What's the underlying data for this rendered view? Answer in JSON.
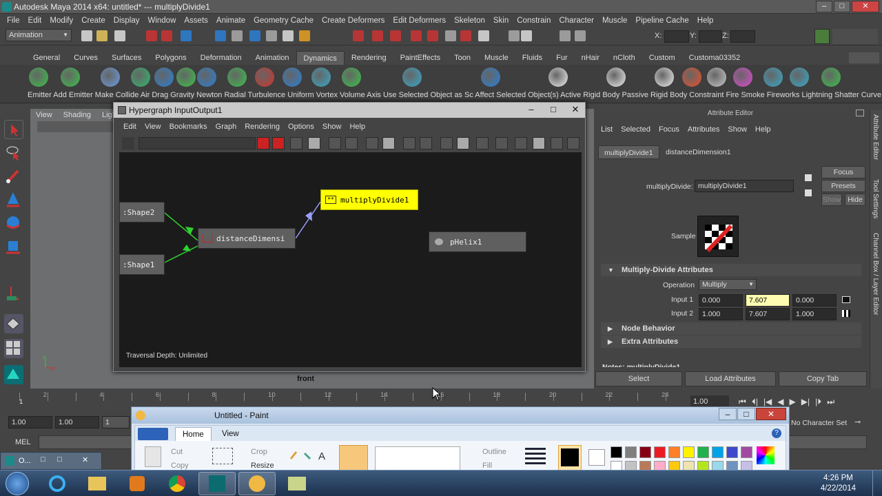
{
  "window": {
    "title": "Autodesk Maya 2014 x64: untitled*   ---   multiplyDivide1",
    "min": "–",
    "max": "□",
    "close": "✕"
  },
  "menubar": [
    "File",
    "Edit",
    "Modify",
    "Create",
    "Display",
    "Window",
    "Assets",
    "Animate",
    "Geometry Cache",
    "Create Deformers",
    "Edit Deformers",
    "Skeleton",
    "Skin",
    "Constrain",
    "Character",
    "Muscle",
    "Pipeline Cache",
    "Help"
  ],
  "statusline": {
    "menuset": "Animation",
    "x_label": "X:",
    "y_label": "Y:",
    "z_label": "Z:"
  },
  "shelf_tabs": [
    "General",
    "Curves",
    "Surfaces",
    "Polygons",
    "Deformation",
    "Animation",
    "Dynamics",
    "Rendering",
    "PaintEffects",
    "Toon",
    "Muscle",
    "Fluids",
    "Fur",
    "nHair",
    "nCloth",
    "Custom",
    "Customa03352"
  ],
  "shelf_active": "Dynamics",
  "shelf_labels": "Emitter Add Emitter Make Collide   Air   Drag  Gravity Newton Radial  Turbulence Uniform Vortex  Volume Axis Use Selected Object as Sc Affect Selected Object(s) Active Rigid Body Passive Rigid Body Constraint   Fire   Smoke Fireworks Lightning Shatter  Curve Flow",
  "viewport": {
    "menus": [
      "View",
      "Shading",
      "Lighti"
    ],
    "label": "front"
  },
  "hypergraph": {
    "title": "Hypergraph InputOutput1",
    "min": "–",
    "max": "□",
    "close": "✕",
    "menus": [
      "Edit",
      "View",
      "Bookmarks",
      "Graph",
      "Rendering",
      "Options",
      "Show",
      "Help"
    ],
    "nodes": {
      "shape2": ":Shape2",
      "shape1": ":Shape1",
      "distance": "distanceDimensi",
      "multiply": "multiplyDivide1",
      "helix": "pHelix1"
    },
    "traversal": "Traversal Depth: Unlimited"
  },
  "attribute_editor": {
    "title": "Attribute Editor",
    "menus": [
      "List",
      "Selected",
      "Focus",
      "Attributes",
      "Show",
      "Help"
    ],
    "tabs": [
      "multiplyDivide1",
      "distanceDimension1"
    ],
    "node_type_label": "multiplyDivide:",
    "node_name": "multiplyDivide1",
    "buttons": {
      "focus": "Focus",
      "presets": "Presets",
      "show": "Show",
      "hide": "Hide"
    },
    "sample_label": "Sample",
    "section_main": "Multiply-Divide Attributes",
    "operation_label": "Operation",
    "operation_value": "Multiply",
    "input1_label": "Input 1",
    "input1": [
      "0.000",
      "7.607",
      "0.000"
    ],
    "input2_label": "Input 2",
    "input2": [
      "1.000",
      "7.607",
      "1.000"
    ],
    "section_node_behavior": "Node Behavior",
    "section_extra": "Extra Attributes",
    "notes": "Notes: multiplyDivide1",
    "bottom": {
      "select": "Select",
      "load": "Load Attributes",
      "copy": "Copy Tab"
    }
  },
  "side_tabs": [
    "Attribute Editor",
    "Tool Settings",
    "Channel Box / Layer Editor"
  ],
  "time_slider": {
    "ticks": [
      "1",
      "2",
      "4",
      "6",
      "8",
      "10",
      "12",
      "14",
      "16",
      "18",
      "20",
      "22",
      "24"
    ],
    "current": "1",
    "end_value": "1.00"
  },
  "range": {
    "start": "1.00",
    "start2": "1.00",
    "mid": "1",
    "character_set": "No Character Set"
  },
  "mel_label": "MEL",
  "paint": {
    "title": "Untitled - Paint",
    "tabs": [
      "Home",
      "View"
    ],
    "clipboard": {
      "cut": "Cut",
      "copy": "Copy"
    },
    "image": {
      "crop": "Crop",
      "resize": "Resize"
    },
    "shapes": {
      "outline": "Outline",
      "fill": "Fill"
    },
    "colors": [
      "#000000",
      "#7f7f7f",
      "#880015",
      "#ed1c24",
      "#ff7f27",
      "#fff200",
      "#22b14c",
      "#00a2e8",
      "#3f48cc",
      "#a349a4",
      "#ffffff",
      "#c3c3c3",
      "#b97a57",
      "#ffaec9",
      "#ffc90e",
      "#efe4b0",
      "#b5e61d",
      "#99d9ea",
      "#7092be",
      "#c8bfe7"
    ]
  },
  "ghost_window": {
    "label": "O...",
    "max": "□",
    "close": "✕"
  },
  "taskbar": {
    "time": "4:26 PM",
    "date": "4/22/2014"
  }
}
